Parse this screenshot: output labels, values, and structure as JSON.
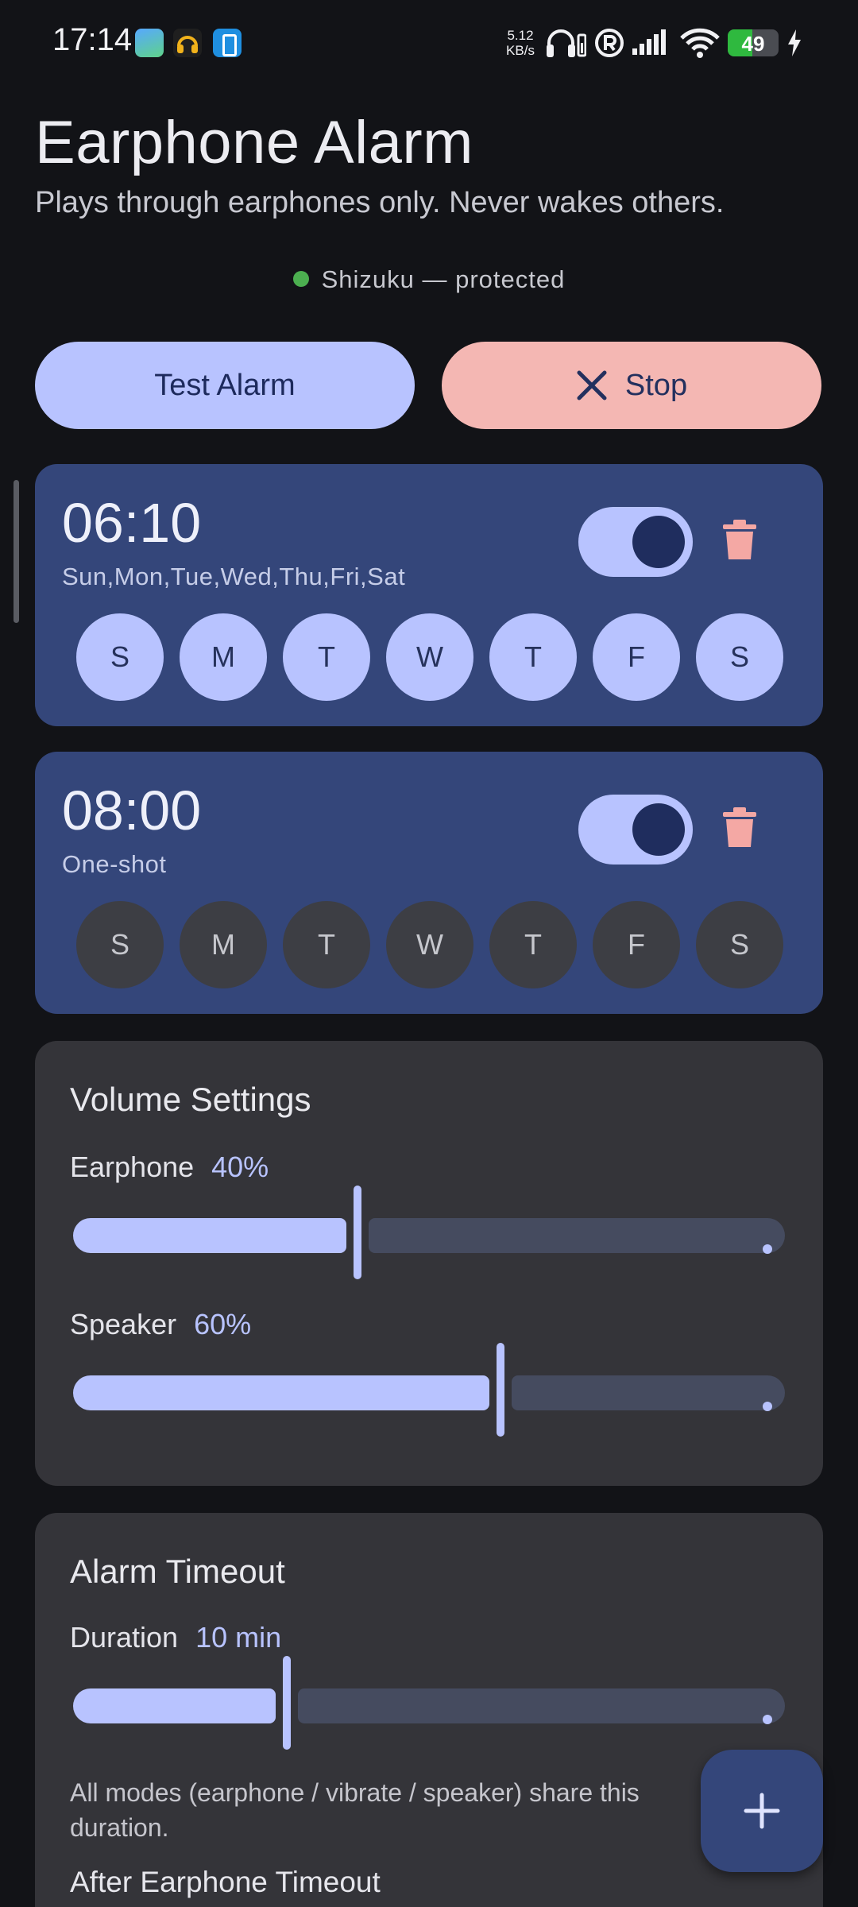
{
  "status_bar": {
    "time": "17:14",
    "net_speed_value": "5.12",
    "net_speed_unit": "KB/s",
    "battery_level": "49",
    "battery_fraction": 0.49,
    "icons": [
      "gallery-app-icon",
      "headphones-app-icon",
      "phone-app-icon",
      "headphones-icon",
      "registered-icon",
      "signal-icon",
      "wifi-icon",
      "battery-icon",
      "charging-icon"
    ]
  },
  "header": {
    "title": "Earphone Alarm",
    "subtitle": "Plays through earphones only. Never wakes others.",
    "status_text": "Shizuku — protected",
    "status_color": "#4caf50"
  },
  "actions": {
    "test_label": "Test Alarm",
    "stop_label": "Stop"
  },
  "alarms": [
    {
      "time": "06:10",
      "repeat": "Sun,Mon,Tue,Wed,Thu,Fri,Sat",
      "enabled": true,
      "days": [
        {
          "label": "S",
          "active": true
        },
        {
          "label": "M",
          "active": true
        },
        {
          "label": "T",
          "active": true
        },
        {
          "label": "W",
          "active": true
        },
        {
          "label": "T",
          "active": true
        },
        {
          "label": "F",
          "active": true
        },
        {
          "label": "S",
          "active": true
        }
      ]
    },
    {
      "time": "08:00",
      "repeat": "One-shot",
      "enabled": true,
      "days": [
        {
          "label": "S",
          "active": false
        },
        {
          "label": "M",
          "active": false
        },
        {
          "label": "T",
          "active": false
        },
        {
          "label": "W",
          "active": false
        },
        {
          "label": "T",
          "active": false
        },
        {
          "label": "F",
          "active": false
        },
        {
          "label": "S",
          "active": false
        }
      ]
    }
  ],
  "volume": {
    "title": "Volume Settings",
    "earphone": {
      "label": "Earphone",
      "value_text": "40%",
      "fraction": 0.4
    },
    "speaker": {
      "label": "Speaker",
      "value_text": "60%",
      "fraction": 0.6
    }
  },
  "timeout": {
    "title": "Alarm Timeout",
    "duration": {
      "label": "Duration",
      "value_text": "10 min",
      "fraction": 0.3
    },
    "note": "All modes (earphone / vibrate / speaker) share this duration.",
    "after_label": "After Earphone Timeout"
  },
  "colors": {
    "accent": "#b8c3ff",
    "alarm_card": "#34467a",
    "stop_button": "#f4b7b3",
    "background": "#121317",
    "panel": "#343439"
  }
}
